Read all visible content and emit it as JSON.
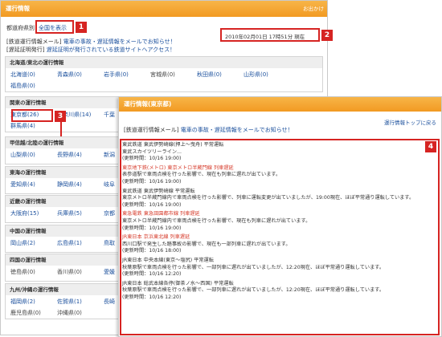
{
  "back": {
    "header": "運行情報",
    "header_right": "お出かけ",
    "pref_label": "都道府県別",
    "all_button": "全国を表示",
    "mail_label": "[鉄道運行情報メール]",
    "mail_link": "電車の事故・遅延情報をメールでお知らせ！",
    "site_label": "[遅延証明発行]",
    "site_link": "遅延証明が発行されている鉄道サイトへアクセス！",
    "timestamp": "2010年02月01日 17時51分 現在",
    "sections": [
      {
        "title": "北海道/東北の運行情報",
        "rows": [
          [
            "北海道(0)",
            "青森県(0)",
            "岩手県(0)",
            "宮城県(0)",
            "秋田県(0)",
            "山形県(0)"
          ],
          [
            "福島県(0)"
          ]
        ]
      },
      {
        "title": "関東の運行情報",
        "rows": [
          [
            "東京都(26)",
            "神奈川県(14)",
            "千葉"
          ],
          [
            "群馬県(4)"
          ]
        ]
      },
      {
        "title": "甲信越/北陸の運行情報",
        "rows": [
          [
            "山梨県(0)",
            "長野県(4)",
            "新潟"
          ]
        ]
      },
      {
        "title": "東海の運行情報",
        "rows": [
          [
            "愛知県(4)",
            "静岡県(4)",
            "岐阜"
          ]
        ]
      },
      {
        "title": "近畿の運行情報",
        "rows": [
          [
            "大阪府(15)",
            "兵庫県(5)",
            "京都"
          ]
        ]
      },
      {
        "title": "中国の運行情報",
        "rows": [
          [
            "岡山県(2)",
            "広島県(1)",
            "鳥取"
          ]
        ]
      },
      {
        "title": "四国の運行情報",
        "rows": [
          [
            "徳島県(0)",
            "香川県(0)",
            "愛媛"
          ]
        ]
      },
      {
        "title": "九州/沖縄の運行情報",
        "rows": [
          [
            "福岡県(2)",
            "佐賀県(1)",
            "長崎"
          ],
          [
            "鹿児島県(0)",
            "沖縄県(0)"
          ]
        ]
      }
    ]
  },
  "front": {
    "header": "運行情報(東京都)",
    "back_link": "運行情報トップに戻る",
    "mail_label": "[鉄道運行情報メール]",
    "mail_link": "電車の事故・遅延情報をメールでお知らせ！",
    "items": [
      {
        "line": "東武鉄道 東武伊勢崎線(押上〜曳舟) 平常運転",
        "red": false,
        "desc": "東武スカイツリーライン...",
        "time": "(更新時間：10/16 19:00)"
      },
      {
        "line": "東京地下鉄(メトロ) 東京メトロ半蔵門線 列車遅延",
        "red": true,
        "desc": "表参道駅で車両点検を行った影響で、現在も列車に遅れが出ています。",
        "time": "(更新時間：10/16 19:00)"
      },
      {
        "line": "東武鉄道 東武伊勢崎線 平常運転",
        "red": false,
        "desc": "東京メトロ半蔵門線内で車両点検を行った影響で、列車に運転変更が出ていましたが、19:00現在、ほぼ平常通り運転しています。",
        "time": "(更新時間：10/16 19:00)"
      },
      {
        "line": "東急電鉄 東急田園都市線 列車遅延",
        "red": true,
        "desc": "東京メトロ半蔵門線内で車両点検を行った影響で、現在も列車に遅れが出ています。",
        "time": "(更新時間：10/16 19:00)"
      },
      {
        "line": "JR東日本 京浜東北線 列車遅延",
        "red": true,
        "desc": "西川口駅で発生した踏事故の影響で、現在も一部列車に遅れが出ています。",
        "time": "(更新時間：10/16 18:00)"
      },
      {
        "line": "JR東日本 中央本線(東京〜塩尻) 平常運転",
        "red": false,
        "desc": "秋葉原駅で車両点検を行った影響で、一部列車に遅れが出ていましたが、12:20現在、ほぼ平常通り運転しています。",
        "time": "(更新時間：10/16 12:20)"
      },
      {
        "line": "JR東日本 総武本線各停(御茶ノ水〜西国) 平常運転",
        "red": false,
        "desc": "秋葉原駅で車両点検を行った影響で、一部列車に遅れが出ていましたが、12:20現在、ほぼ平常通り運転しています。",
        "time": "(更新時間：10/16 12:20)"
      }
    ]
  },
  "badges": [
    "1",
    "2",
    "3",
    "4"
  ],
  "colors": {
    "accent": "#f29a22",
    "annotation": "#d62422",
    "link": "#1a4f9c"
  }
}
